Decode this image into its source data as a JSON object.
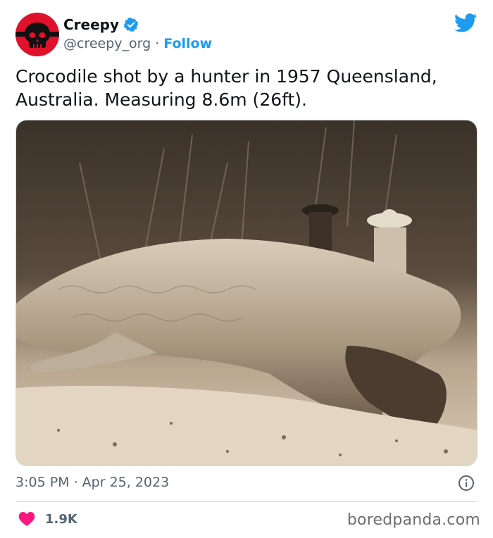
{
  "author": {
    "display_name": "Creepy",
    "handle": "@creepy_org",
    "separator": "·",
    "follow_label": "Follow",
    "avatar_color": "#e0112b",
    "verified": true
  },
  "tweet": {
    "text": "Crocodile shot by a hunter in 1957 Queensland,\nAustralia. Measuring 8.6m (26ft).",
    "timestamp": "3:05 PM · Apr 25, 2023",
    "likes": "1.9K"
  },
  "icons": {
    "platform": "twitter-bird-icon",
    "verified": "verified-badge-icon",
    "info": "info-icon",
    "like": "heart-icon"
  },
  "colors": {
    "accent": "#1d9bf0",
    "like": "#f91880",
    "secondary_text": "#536471"
  },
  "watermark": "boredpanda.com"
}
